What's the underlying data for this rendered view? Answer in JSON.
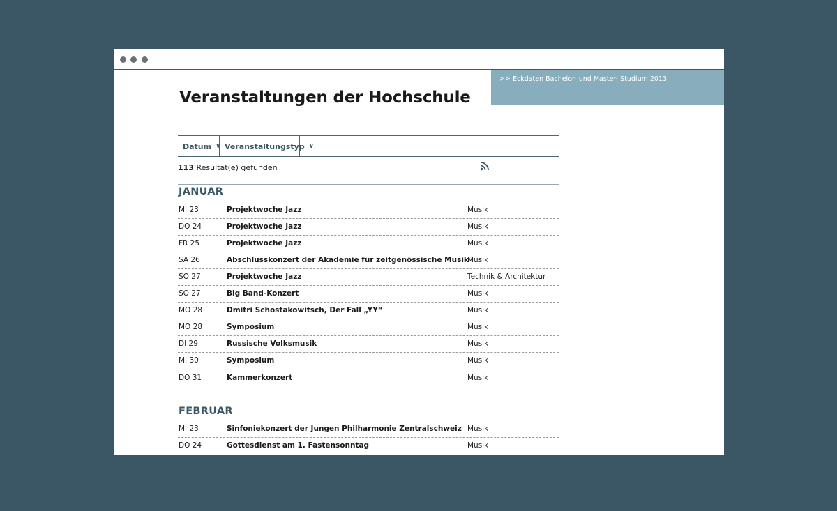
{
  "promo": {
    "link": ">> Eckdaten Bachelor- und Master- Studium 2013"
  },
  "page": {
    "title": "Veranstaltungen der Hochschule"
  },
  "filters": [
    {
      "label": "Datum"
    },
    {
      "label": "Veranstaltungstyp"
    }
  ],
  "results": {
    "count": "113",
    "label": "Resultat(e) gefunden"
  },
  "months": [
    {
      "name": "JANUAR",
      "events": [
        {
          "date": "MI 23",
          "title": "Projektwoche Jazz",
          "type": "Musik"
        },
        {
          "date": "DO 24",
          "title": "Projektwoche Jazz",
          "type": "Musik"
        },
        {
          "date": "FR 25",
          "title": "Projektwoche Jazz",
          "type": "Musik"
        },
        {
          "date": "SA 26",
          "title": "Abschlusskonzert der Akademie für zeitgenössische Musik",
          "type": "Musik"
        },
        {
          "date": "SO 27",
          "title": "Projektwoche Jazz",
          "type": "Technik & Architektur"
        },
        {
          "date": "SO 27",
          "title": "Big Band-Konzert",
          "type": "Musik"
        },
        {
          "date": "MO 28",
          "title": "Dmitri Schostakowitsch, Der Fall „YY“",
          "type": "Musik"
        },
        {
          "date": "MO 28",
          "title": "Symposium",
          "type": "Musik"
        },
        {
          "date": "DI 29",
          "title": "Russische Volksmusik",
          "type": "Musik"
        },
        {
          "date": "MI 30",
          "title": "Symposium",
          "type": "Musik"
        },
        {
          "date": "DO 31",
          "title": "Kammerkonzert",
          "type": "Musik"
        }
      ]
    },
    {
      "name": "FEBRUAR",
      "events": [
        {
          "date": "MI 23",
          "title": "Sinfoniekonzert der Jungen Philharmonie Zentralschweiz",
          "type": "Musik"
        },
        {
          "date": "DO 24",
          "title": "Gottesdienst am 1. Fastensonntag",
          "type": "Musik"
        }
      ]
    }
  ],
  "colors": {
    "background": "#3b5664",
    "accent": "#3d5866",
    "promo": "#88aebd"
  }
}
